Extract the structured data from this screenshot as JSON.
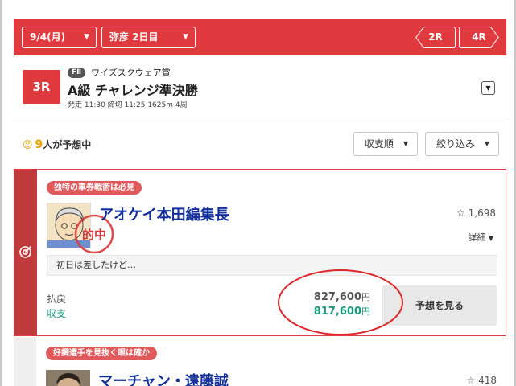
{
  "header": {
    "date_select": "9/4(月)",
    "venue_select": "弥彦 2日目",
    "prev_race": "2R",
    "next_race": "4R"
  },
  "race": {
    "number": "3R",
    "grade": "FⅡ",
    "sponsor": "ワイズスクウェア賞",
    "title": "A級 チャレンジ準決勝",
    "info": "発走 11:30 締切 11:25 1625m 4周",
    "expand_symbol": "▼"
  },
  "forecasters": {
    "count": "9",
    "count_suffix": "人が予想中",
    "sort_label": "収支順",
    "filter_label": "絞り込み"
  },
  "cards": [
    {
      "tag": "独特の車券戦術は必見",
      "name": "アオケイ本田編集長",
      "favorites": "1,698",
      "detail_label": "詳細",
      "comment": "初日は差したけど…",
      "payout_label": "払戻",
      "balance_label": "収支",
      "payout_value": "827,600",
      "balance_value": "817,600",
      "yen": "円",
      "hit_stamp": "的中",
      "view_button": "予想を見る"
    },
    {
      "tag": "好調選手を見抜く眼は確か",
      "name": "マーチャン・遠藤誠",
      "favorites": "418"
    }
  ],
  "colors": {
    "brand_red": "#e03a3e",
    "name_blue": "#12309a",
    "balance_green": "#1a9a7c",
    "accent_orange": "#f0a000"
  }
}
